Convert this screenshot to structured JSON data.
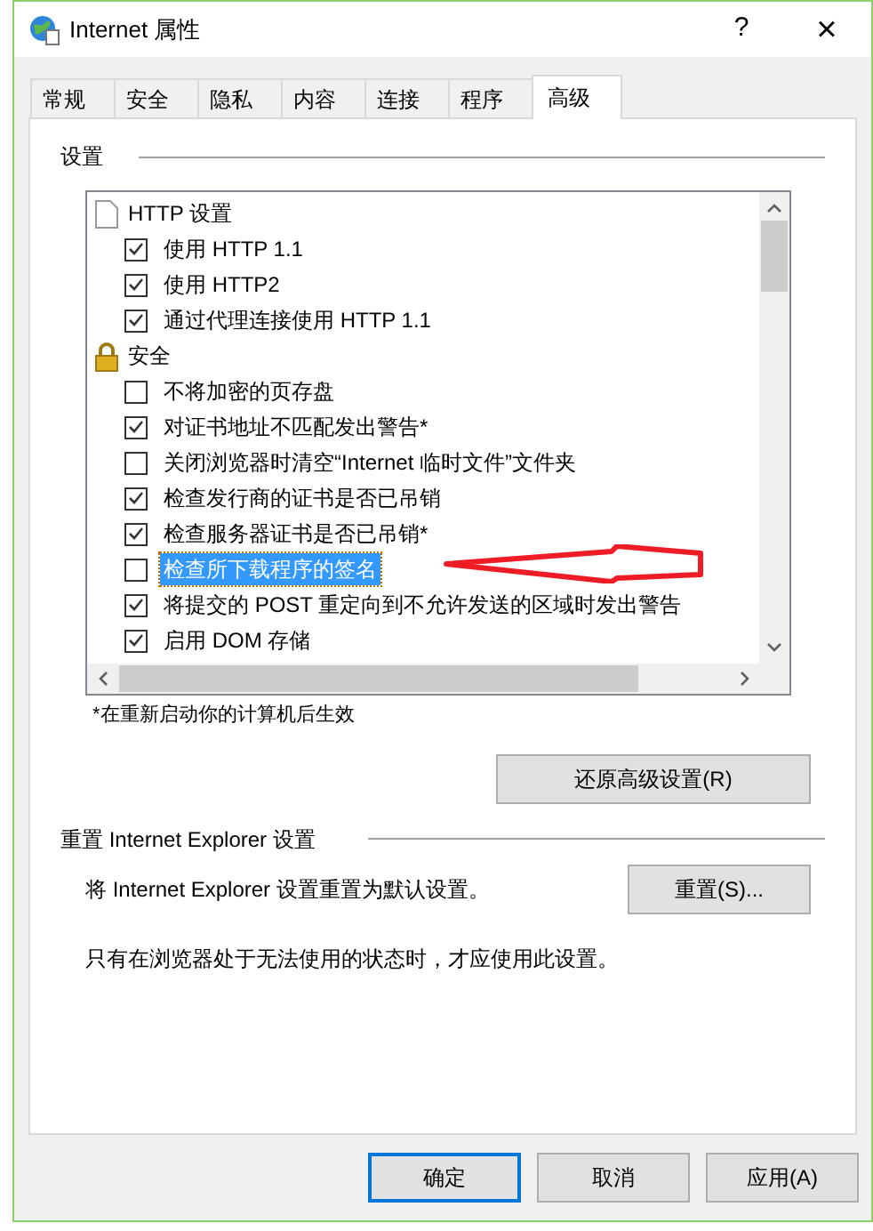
{
  "window": {
    "title": "Internet 属性",
    "help": "?",
    "close": "×"
  },
  "tabs": [
    {
      "label": "常规",
      "selected": false
    },
    {
      "label": "安全",
      "selected": false
    },
    {
      "label": "隐私",
      "selected": false
    },
    {
      "label": "内容",
      "selected": false
    },
    {
      "label": "连接",
      "selected": false
    },
    {
      "label": "程序",
      "selected": false
    },
    {
      "label": "高级",
      "selected": true
    }
  ],
  "settings": {
    "title": "设置",
    "items": [
      {
        "kind": "group",
        "label": "HTTP 设置"
      },
      {
        "kind": "option",
        "label": "使用 HTTP 1.1",
        "checked": true,
        "selected": false
      },
      {
        "kind": "option",
        "label": "使用 HTTP2",
        "checked": true,
        "selected": false
      },
      {
        "kind": "option",
        "label": "通过代理连接使用 HTTP 1.1",
        "checked": true,
        "selected": false
      },
      {
        "kind": "group",
        "label": "安全"
      },
      {
        "kind": "option",
        "label": "不将加密的页存盘",
        "checked": false,
        "selected": false
      },
      {
        "kind": "option",
        "label": "对证书地址不匹配发出警告*",
        "checked": true,
        "selected": false
      },
      {
        "kind": "option",
        "label": "关闭浏览器时清空“Internet 临时文件”文件夹",
        "checked": false,
        "selected": false
      },
      {
        "kind": "option",
        "label": "检查发行商的证书是否已吊销",
        "checked": true,
        "selected": false
      },
      {
        "kind": "option",
        "label": "检查服务器证书是否已吊销*",
        "checked": true,
        "selected": false
      },
      {
        "kind": "option",
        "label": "检查所下载程序的签名",
        "checked": false,
        "selected": true
      },
      {
        "kind": "option",
        "label": "将提交的 POST 重定向到不允许发送的区域时发出警告",
        "checked": true,
        "selected": false
      },
      {
        "kind": "option",
        "label": "启用 DOM 存储",
        "checked": true,
        "selected": false
      }
    ],
    "note": "*在重新启动你的计算机后生效",
    "restore_button": "还原高级设置(R)"
  },
  "reset": {
    "title": "重置 Internet Explorer 设置",
    "description": "将 Internet Explorer 设置重置为默认设置。",
    "button": "重置(S)...",
    "note": "只有在浏览器处于无法使用的状态时，才应使用此设置。"
  },
  "buttons": [
    {
      "label": "确定",
      "focused": true
    },
    {
      "label": "取消",
      "focused": false
    },
    {
      "label": "应用(A)",
      "focused": false
    }
  ]
}
